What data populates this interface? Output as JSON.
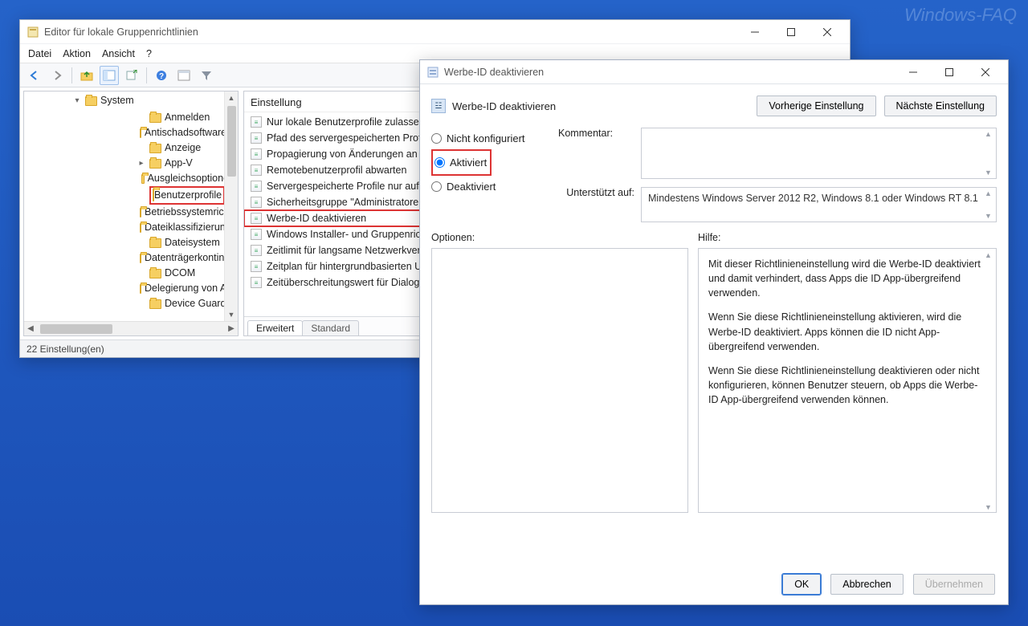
{
  "watermark": "Windows-FAQ",
  "editor": {
    "title": "Editor für lokale Gruppenrichtlinien",
    "menu": {
      "file": "Datei",
      "action": "Aktion",
      "view": "Ansicht",
      "help": "?"
    },
    "toolbar": {
      "back": "back-icon",
      "forward": "forward-icon",
      "up": "up-icon",
      "list": "list-icon",
      "export": "export-icon",
      "help": "help-icon",
      "panel": "panel-icon",
      "filter": "filter-icon"
    },
    "tree": {
      "system": "System",
      "items": [
        "Anmelden",
        "Antischadsoftware-Frühst",
        "Anzeige",
        "App-V",
        "Ausgleichsoptionen",
        "Benutzerprofile",
        "Betriebssystemrichtlinien",
        "Dateiklassifizierungsinfra",
        "Dateisystem",
        "Datenträgerkontingente",
        "DCOM",
        "Delegierung von Anmeld",
        "Device Guard"
      ],
      "highlightIndex": 5,
      "expandableIndex": 3
    },
    "settings": {
      "header": "Einstellung",
      "items": [
        "Nur lokale Benutzerprofile zulassen",
        "Pfad des servergespeicherten Profil",
        "Propagierung von Änderungen an",
        "Remotebenutzerprofil abwarten",
        "Servergespeicherte Profile nur auf p",
        "Sicherheitsgruppe \"Administratoren",
        "Werbe-ID deaktivieren",
        "Windows Installer- und Gruppenric",
        "Zeitlimit für langsame Netzwerkverb",
        "Zeitplan für hintergrundbasierten U",
        "Zeitüberschreitungswert für Dialog"
      ],
      "highlightIndex": 6,
      "tabs": {
        "extended": "Erweitert",
        "standard": "Standard"
      }
    },
    "status": "22 Einstellung(en)"
  },
  "dialog": {
    "title": "Werbe-ID deaktivieren",
    "heading": "Werbe-ID deaktivieren",
    "nav": {
      "prev": "Vorherige Einstellung",
      "next": "Nächste Einstellung"
    },
    "radios": {
      "not_configured": "Nicht konfiguriert",
      "enabled": "Aktiviert",
      "disabled": "Deaktiviert",
      "selected": "enabled"
    },
    "labels": {
      "comment": "Kommentar:",
      "supported": "Unterstützt auf:",
      "options": "Optionen:",
      "help": "Hilfe:"
    },
    "supported_text": "Mindestens Windows Server 2012 R2, Windows 8.1 oder Windows RT 8.1",
    "help_text": {
      "p1": "Mit dieser Richtlinieneinstellung wird die Werbe-ID deaktiviert und damit verhindert, dass Apps die ID App-übergreifend verwenden.",
      "p2": "Wenn Sie diese Richtlinieneinstellung aktivieren, wird die Werbe-ID deaktiviert. Apps können die ID nicht App-übergreifend verwenden.",
      "p3": "Wenn Sie diese Richtlinieneinstellung deaktivieren oder nicht konfigurieren, können Benutzer steuern, ob Apps die Werbe-ID App-übergreifend verwenden können."
    },
    "buttons": {
      "ok": "OK",
      "cancel": "Abbrechen",
      "apply": "Übernehmen"
    }
  }
}
